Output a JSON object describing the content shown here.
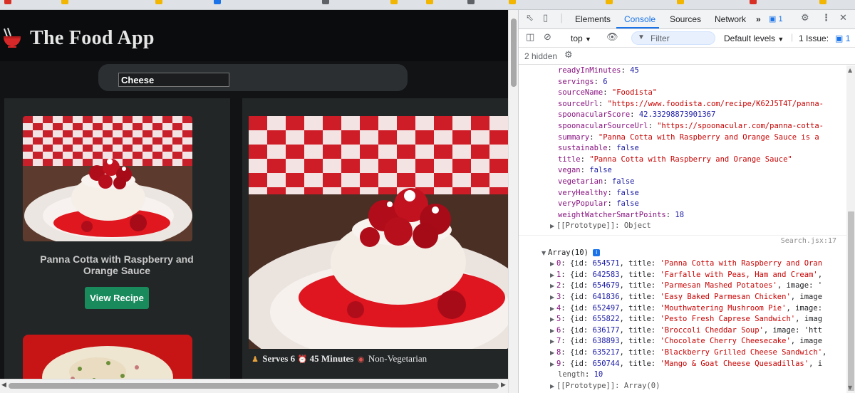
{
  "app": {
    "title": "The Food App",
    "search": {
      "value": "Cheese"
    },
    "card": {
      "title": "Panna Cotta with Raspberry and Orange Sauce",
      "button_label": "View Recipe"
    },
    "detail": {
      "serves_label": "Serves 6",
      "minutes_label": "45 Minutes",
      "diet_label": "Non-Vegetarian"
    }
  },
  "devtools": {
    "tabs": [
      {
        "label": "Elements"
      },
      {
        "label": "Console"
      },
      {
        "label": "Sources"
      },
      {
        "label": "Network"
      }
    ],
    "more_tabs": "»",
    "message_count": "1",
    "context": "top",
    "filter_placeholder": "Filter",
    "levels": "Default levels",
    "issues": "1 Issue:",
    "issues_count": "1",
    "hidden": "2 hidden",
    "object_props": [
      {
        "key": "readyInMinutes",
        "value": "45",
        "kind": "num"
      },
      {
        "key": "servings",
        "value": "6",
        "kind": "num"
      },
      {
        "key": "sourceName",
        "value": "\"Foodista\"",
        "kind": "str"
      },
      {
        "key": "sourceUrl",
        "value": "\"https://www.foodista.com/recipe/K62J5T4T/panna-",
        "kind": "str"
      },
      {
        "key": "spoonacularScore",
        "value": "42.33298873901367",
        "kind": "num"
      },
      {
        "key": "spoonacularSourceUrl",
        "value": "\"https://spoonacular.com/panna-cotta-",
        "kind": "str"
      },
      {
        "key": "summary",
        "value": "\"Panna Cotta with Raspberry and Orange Sauce is a ",
        "kind": "str"
      },
      {
        "key": "sustainable",
        "value": "false",
        "kind": "num"
      },
      {
        "key": "title",
        "value": "\"Panna Cotta with Raspberry and Orange Sauce\"",
        "kind": "str"
      },
      {
        "key": "vegan",
        "value": "false",
        "kind": "num"
      },
      {
        "key": "vegetarian",
        "value": "false",
        "kind": "num"
      },
      {
        "key": "veryHealthy",
        "value": "false",
        "kind": "num"
      },
      {
        "key": "veryPopular",
        "value": "false",
        "kind": "num"
      },
      {
        "key": "weightWatcherSmartPoints",
        "value": "18",
        "kind": "num"
      }
    ],
    "prototype_object": "[[Prototype]]: Object",
    "source_link": "Search.jsx:17",
    "array_header": "Array(10)",
    "array_items": [
      {
        "idx": "0",
        "id": "654571",
        "title": "'Panna Cotta with Raspberry and Oran",
        "tail": ""
      },
      {
        "idx": "1",
        "id": "642583",
        "title": "'Farfalle with Peas, Ham and Cream'",
        "tail": ","
      },
      {
        "idx": "2",
        "id": "654679",
        "title": "'Parmesan Mashed Potatoes'",
        "tail": ", image: '"
      },
      {
        "idx": "3",
        "id": "641836",
        "title": "'Easy Baked Parmesan Chicken'",
        "tail": ", image"
      },
      {
        "idx": "4",
        "id": "652497",
        "title": "'Mouthwatering Mushroom Pie'",
        "tail": ", image:"
      },
      {
        "idx": "5",
        "id": "655822",
        "title": "'Pesto Fresh Caprese Sandwich'",
        "tail": ", imag"
      },
      {
        "idx": "6",
        "id": "636177",
        "title": "'Broccoli Cheddar Soup'",
        "tail": ", image: 'htt"
      },
      {
        "idx": "7",
        "id": "638893",
        "title": "'Chocolate Cherry Cheesecake'",
        "tail": ", image"
      },
      {
        "idx": "8",
        "id": "635217",
        "title": "'Blackberry Grilled Cheese Sandwich'",
        "tail": ","
      },
      {
        "idx": "9",
        "id": "650744",
        "title": "'Mango & Goat Cheese Quesadillas'",
        "tail": ", i"
      }
    ],
    "length_key": "length",
    "length_value": "10",
    "prototype_array": "[[Prototype]]: Array(0)"
  },
  "colors": {
    "app_bg": "#111315",
    "card_bg": "#222627",
    "button_green": "#188a5c",
    "devtools_accent": "#1a73e8"
  }
}
